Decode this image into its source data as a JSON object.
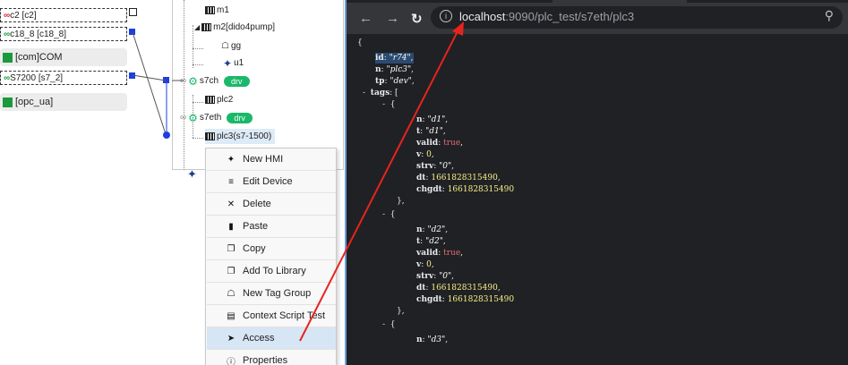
{
  "left_panel": {
    "connectors": [
      {
        "label": "c2 [c2]",
        "icon": "link-broken-icon"
      },
      {
        "label": "c18_8 [c18_8]",
        "icon": "link-icon"
      },
      {
        "label": "[com]COM",
        "icon": "green-square-icon"
      },
      {
        "label": "S7200 [s7_2]",
        "icon": "link-icon"
      },
      {
        "label": "[opc_ua]",
        "icon": "green-square-icon"
      }
    ]
  },
  "tree": {
    "nodes": {
      "m1": "m1",
      "m2": "m2[dido4pump]",
      "gg": "gg",
      "u1": "u1",
      "s7ch": "s7ch",
      "s7ch_badge": "drv",
      "plc2": "plc2",
      "s7eth": "s7eth",
      "s7eth_badge": "drv",
      "plc3": "plc3(s7-1500)"
    }
  },
  "context_menu": {
    "items": [
      {
        "label": "New HMI",
        "icon": "puzzle-icon"
      },
      {
        "label": "Edit Device",
        "icon": "list-edit-icon"
      },
      {
        "label": "Delete",
        "icon": "close-icon"
      },
      {
        "label": "Paste",
        "icon": "clipboard-icon"
      },
      {
        "label": "Copy",
        "icon": "copy-icon"
      },
      {
        "label": "Add To Library",
        "icon": "copy-icon"
      },
      {
        "label": "New Tag Group",
        "icon": "tag-icon"
      },
      {
        "label": "Context Script Test",
        "icon": "list-icon"
      },
      {
        "label": "Access",
        "icon": "send-icon"
      },
      {
        "label": "Properties",
        "icon": "help-circle-icon"
      }
    ],
    "highlighted": "Access"
  },
  "browser": {
    "url_host": "localhost",
    "url_rest": ":9090/plc_test/s7eth/plc3",
    "json_lines": {
      "open_brace": "{",
      "id_key": "id",
      "id_val": "\"r74\"",
      "n_key": "n",
      "n_val": "\"plc3\"",
      "tp_key": "tp",
      "tp_val": "\"dev\"",
      "tags_toggle": "-",
      "tags_key": "tags",
      "tags_open": "[",
      "tags": [
        {
          "n": "\"d1\"",
          "t": "\"d1\"",
          "valid": "true",
          "v": "0",
          "strv": "\"0\"",
          "dt": "1661828315490",
          "chgdt": "1661828315490"
        },
        {
          "n": "\"d2\"",
          "t": "\"d2\"",
          "valid": "true",
          "v": "0",
          "strv": "\"0\"",
          "dt": "1661828315490",
          "chgdt": "1661828315490"
        },
        {
          "n": "\"d3\""
        }
      ]
    }
  },
  "colors": {
    "accent_green": "#1bb86a",
    "port_blue": "#1d3fe0",
    "arrow_red": "#e8231e",
    "browser_bg": "#202124"
  }
}
